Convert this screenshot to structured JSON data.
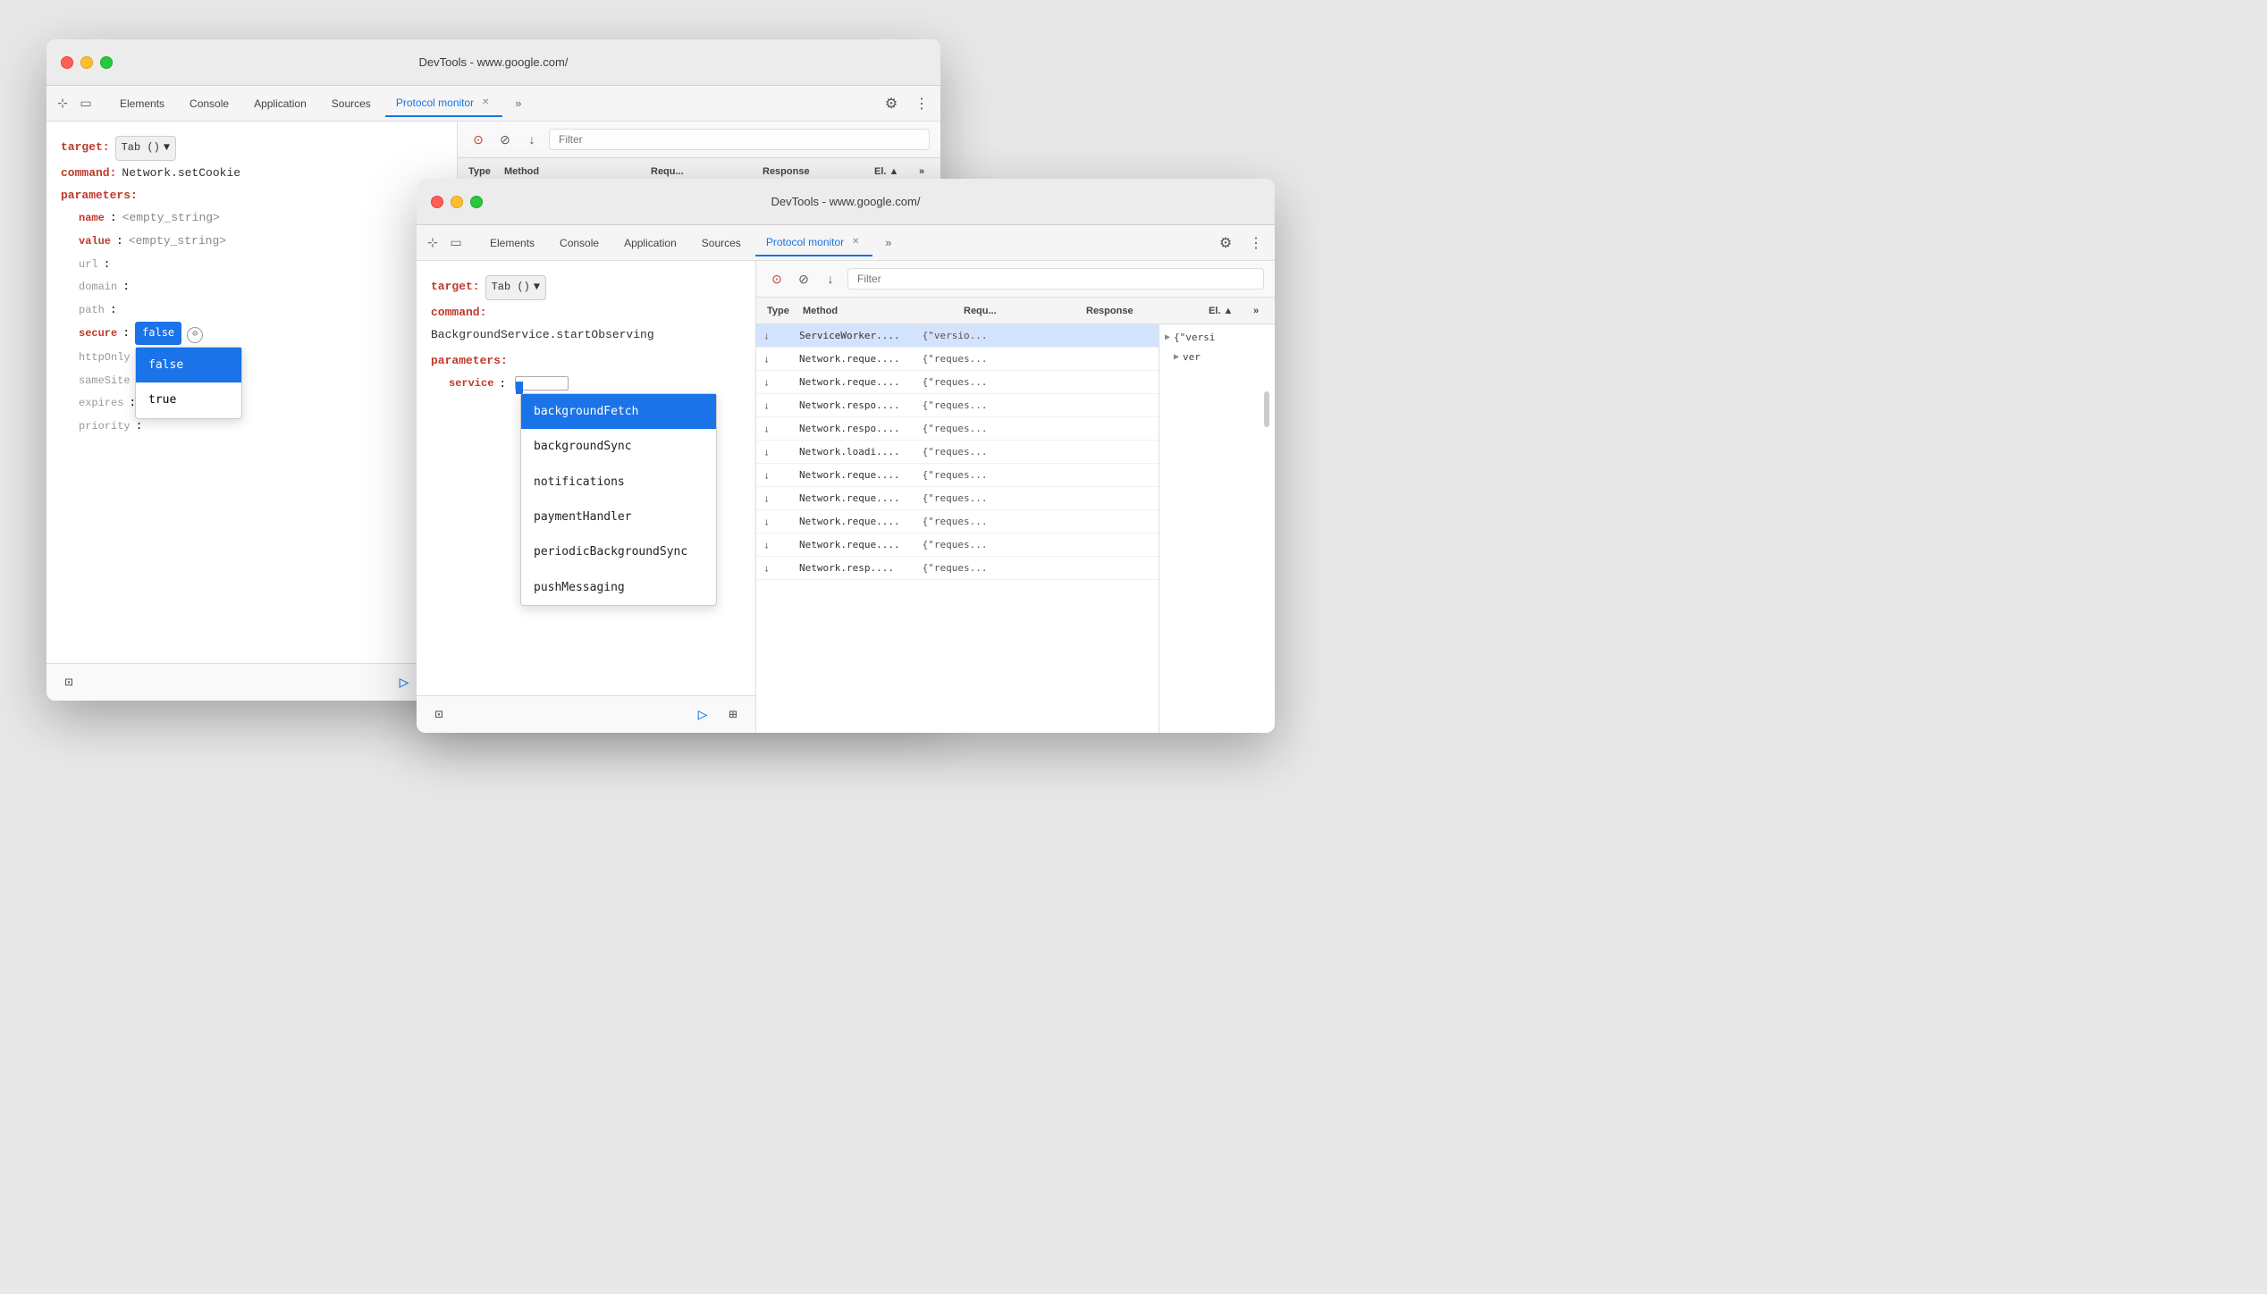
{
  "window1": {
    "title": "DevTools - www.google.com/",
    "tabs": [
      "Elements",
      "Console",
      "Application",
      "Sources"
    ],
    "active_tab": "Protocol monitor",
    "command_panel": {
      "target_label": "target:",
      "target_value": "Tab ()",
      "command_label": "command:",
      "command_value": "Network.setCookie",
      "parameters_label": "parameters:",
      "fields": [
        {
          "key": "name",
          "value": "<empty_string>",
          "type": "string"
        },
        {
          "key": "value",
          "value": "<empty_string>",
          "type": "string"
        },
        {
          "key": "url",
          "value": "",
          "type": "plain"
        },
        {
          "key": "domain",
          "value": "",
          "type": "plain"
        },
        {
          "key": "path",
          "value": "",
          "type": "plain"
        },
        {
          "key": "secure",
          "value": "false",
          "type": "bool",
          "show_dropdown": true
        },
        {
          "key": "httpOnly",
          "value": "",
          "type": "plain"
        },
        {
          "key": "sameSite",
          "value": "",
          "type": "plain"
        },
        {
          "key": "expires",
          "value": "",
          "type": "plain"
        },
        {
          "key": "priority",
          "value": "",
          "type": "plain"
        }
      ],
      "bool_options": [
        "false",
        "true"
      ],
      "selected_bool": "false"
    },
    "filter_placeholder": "Filter",
    "table_headers": [
      "Type",
      "Method",
      "Requ...",
      "Response",
      "El.▲",
      ">>"
    ],
    "table_rows": []
  },
  "window2": {
    "title": "DevTools - www.google.com/",
    "tabs": [
      "Elements",
      "Console",
      "Application",
      "Sources"
    ],
    "active_tab": "Protocol monitor",
    "command_panel": {
      "target_label": "target:",
      "target_value": "Tab ()",
      "command_label": "command:",
      "command_value": "BackgroundService.startObserving",
      "parameters_label": "parameters:",
      "service_label": "service",
      "service_value": ""
    },
    "service_options": [
      {
        "label": "backgroundFetch",
        "selected": true
      },
      {
        "label": "backgroundSync",
        "selected": false
      },
      {
        "label": "notifications",
        "selected": false
      },
      {
        "label": "paymentHandler",
        "selected": false
      },
      {
        "label": "periodicBackgroundSync",
        "selected": false
      },
      {
        "label": "pushMessaging",
        "selected": false
      }
    ],
    "filter_placeholder": "Filter",
    "table_headers": [
      "Type",
      "Method",
      "Requ...",
      "Response",
      "El.▲",
      ">>"
    ],
    "table_rows": [
      {
        "type": "↓",
        "method": "ServiceWorker....",
        "request": "{\"versio...",
        "response": "",
        "selected": true
      },
      {
        "type": "↓",
        "method": "Network.reque....",
        "request": "{\"reques...",
        "response": "",
        "selected": false
      },
      {
        "type": "↓",
        "method": "Network.reque....",
        "request": "{\"reques...",
        "response": "",
        "selected": false
      },
      {
        "type": "↓",
        "method": "Network.respo....",
        "request": "{\"reques...",
        "response": "",
        "selected": false
      },
      {
        "type": "↓",
        "method": "Network.respo....",
        "request": "{\"reques...",
        "response": "",
        "selected": false
      },
      {
        "type": "↓",
        "method": "Network.loadi....",
        "request": "{\"reques...",
        "response": "",
        "selected": false
      },
      {
        "type": "↓",
        "method": "Network.reque....",
        "request": "{\"reques...",
        "response": "",
        "selected": false
      },
      {
        "type": "↓",
        "method": "Network.reque....",
        "request": "{\"reques...",
        "response": "",
        "selected": false
      },
      {
        "type": "↓",
        "method": "Network.reque....",
        "request": "{\"reques...",
        "response": "",
        "selected": false
      },
      {
        "type": "↓",
        "method": "Network.reque....",
        "request": "{\"reques...",
        "response": "",
        "selected": false
      },
      {
        "type": "↓",
        "method": "Network.resp....",
        "request": "{\"reques...",
        "response": "",
        "selected": false
      }
    ],
    "detail_lines": [
      "{\"versi",
      "▶ ver"
    ],
    "colors": {
      "accent": "#1a73e8",
      "selected_row": "#d3e3fd"
    }
  }
}
